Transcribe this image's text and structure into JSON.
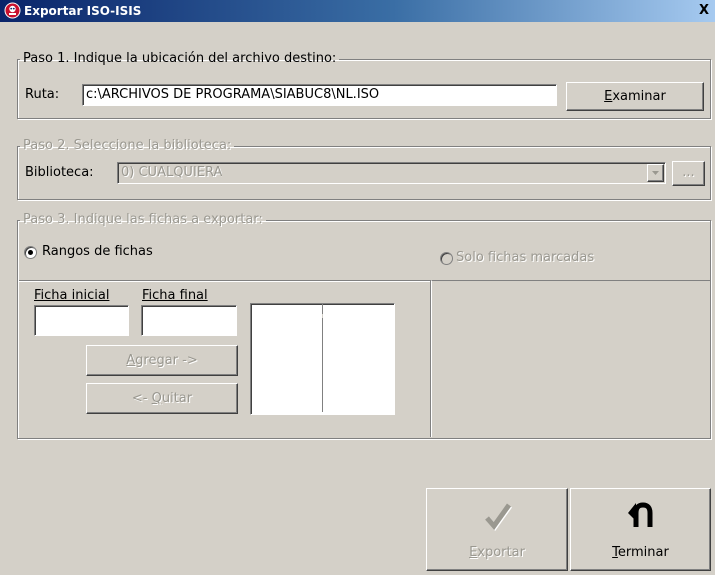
{
  "window": {
    "title": "Exportar ISO-ISIS",
    "close_label": "X"
  },
  "step1": {
    "legend": "Paso 1. Indique la ubicación del archivo destino:",
    "path_label": "Ruta:",
    "path_value": "c:\\ARCHIVOS DE PROGRAMA\\SIABUC8\\NL.ISO",
    "browse_prefix": "",
    "browse_mnemonic": "E",
    "browse_rest": "xaminar"
  },
  "step2": {
    "legend": "Paso 2. Seleccione la biblioteca:",
    "library_label": "Biblioteca:",
    "library_value": "0) CUALQUIERA",
    "ellipsis_label": "..."
  },
  "step3": {
    "legend": "Paso 3. Indique las fichas a exportar:",
    "radio_ranges": "Rangos de fichas",
    "radio_marked": "Solo fichas marcadas",
    "start_label": "Ficha inicial",
    "end_label": "Ficha final",
    "add_mnemonic": "A",
    "add_rest": "gregar  ->",
    "remove_prefix": "<-  ",
    "remove_mnemonic": "Q",
    "remove_rest": "uitar"
  },
  "footer": {
    "export_mnemonic": "E",
    "export_rest": "xportar",
    "finish_mnemonic": "T",
    "finish_rest": "erminar"
  },
  "colors": {
    "face": "#d4d0c8",
    "title_start": "#0a246a",
    "title_end": "#a6caf0",
    "disabled_text": "#9a9890"
  },
  "icons": {
    "app": "app-icon",
    "export": "checkmark-icon",
    "finish": "u-turn-arrow-icon",
    "dropdown": "chevron-down-icon"
  }
}
